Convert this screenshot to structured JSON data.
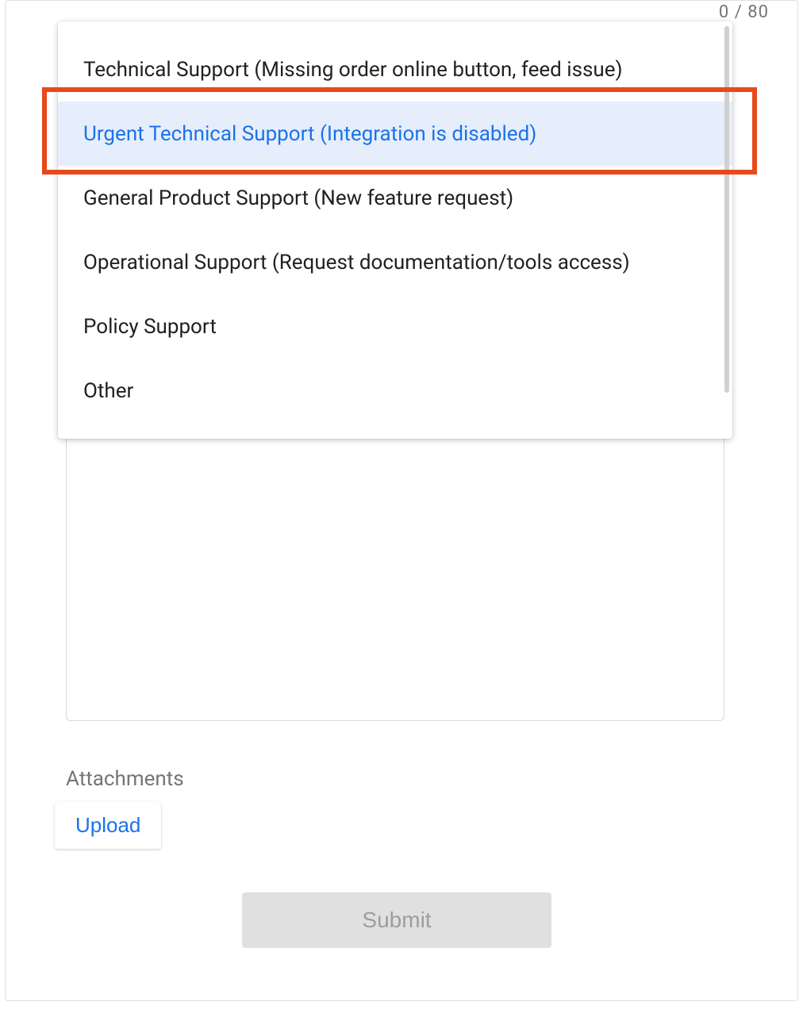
{
  "counter": "0 / 80",
  "dropdown": {
    "options": [
      {
        "label": "Technical Support (Missing order online button, feed issue)"
      },
      {
        "label": "Urgent Technical Support (Integration is disabled)"
      },
      {
        "label": "General Product Support (New feature request)"
      },
      {
        "label": "Operational Support (Request documentation/tools access)"
      },
      {
        "label": "Policy Support"
      },
      {
        "label": "Other"
      }
    ],
    "selected_index": 1
  },
  "textarea": {
    "value": ""
  },
  "attachments": {
    "label": "Attachments",
    "upload_button": "Upload"
  },
  "submit": {
    "label": "Submit"
  }
}
